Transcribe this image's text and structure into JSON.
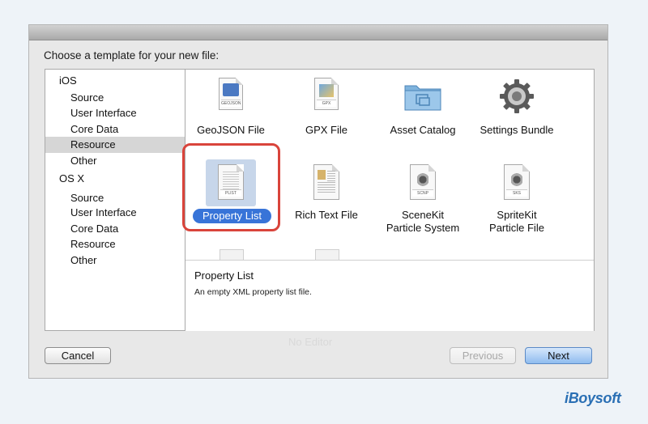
{
  "dialog": {
    "heading": "Choose a template for your new file:",
    "ghost_text": "No Editor"
  },
  "sidebar": {
    "groups": [
      {
        "label": "iOS",
        "items": [
          "Source",
          "User Interface",
          "Core Data",
          "Resource",
          "Other"
        ]
      },
      {
        "label": "OS X",
        "items": [
          "Source",
          "User Interface",
          "Core Data",
          "Resource",
          "Other"
        ]
      }
    ],
    "selected": "iOS / Resource"
  },
  "templates": [
    {
      "label": "GeoJSON File",
      "icon": "geojson-file-icon",
      "tag": "GEOJSON"
    },
    {
      "label": "GPX File",
      "icon": "gpx-file-icon",
      "tag": "GPX"
    },
    {
      "label": "Asset Catalog",
      "icon": "folder-icon"
    },
    {
      "label": "Settings Bundle",
      "icon": "gear-icon"
    },
    {
      "label": "Property List",
      "icon": "plist-file-icon",
      "tag": "PLIST",
      "selected": true
    },
    {
      "label": "Rich Text File",
      "icon": "rtf-file-icon"
    },
    {
      "label_lines": [
        "SceneKit",
        "Particle System"
      ],
      "icon": "scenekit-particle-icon",
      "tag": "SCNP"
    },
    {
      "label_lines": [
        "SpriteKit",
        "Particle File"
      ],
      "icon": "spritekit-particle-icon",
      "tag": "SKS"
    }
  ],
  "description": {
    "title": "Property List",
    "text": "An empty XML property list file."
  },
  "buttons": {
    "cancel": "Cancel",
    "previous": "Previous",
    "next": "Next"
  },
  "watermark": {
    "logo": "iBoysoft"
  },
  "colors": {
    "selection": "#3874d8",
    "highlight_ring": "#d9443b",
    "logo": "#2a6fb4"
  }
}
